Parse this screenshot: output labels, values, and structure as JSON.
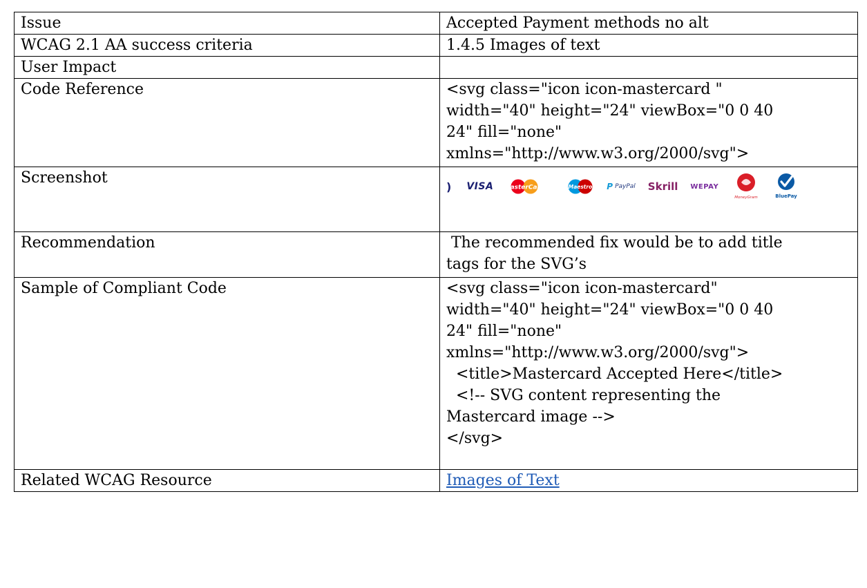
{
  "rows": {
    "issue": {
      "label": "Issue",
      "value": "Accepted Payment methods no alt"
    },
    "criteria": {
      "label": "WCAG 2.1 AA success criteria",
      "value": "1.4.5 Images of text"
    },
    "impact": {
      "label": "User Impact",
      "value": ""
    },
    "code_reference": {
      "label": "Code Reference",
      "value": "<svg class=\"icon icon-mastercard \"\nwidth=\"40\" height=\"24\" viewBox=\"0 0 40\n24\" fill=\"none\"\nxmlns=\"http://www.w3.org/2000/svg\">"
    },
    "screenshot": {
      "label": "Screenshot",
      "logos": {
        "visa": "VISA",
        "mastercard": "MasterCard",
        "maestro": "Maestro",
        "paypal": "PayPal",
        "skrill": "Skrill",
        "wepay": "WEPAY",
        "moneygram": "MoneyGram",
        "bluepay": "BluePay"
      }
    },
    "recommendation": {
      "label": "Recommendation",
      "value": " The recommended fix would be to add title\ntags for the SVG’s"
    },
    "compliant_code": {
      "label": "Sample of Compliant Code",
      "value": "<svg class=\"icon icon-mastercard\"\nwidth=\"40\" height=\"24\" viewBox=\"0 0 40\n24\" fill=\"none\"\nxmlns=\"http://www.w3.org/2000/svg\">\n  <title>Mastercard Accepted Here</title>\n  <!-- SVG content representing the\nMastercard image -->\n</svg>"
    },
    "resource": {
      "label": "Related WCAG Resource",
      "link_text": "Images of Text"
    }
  },
  "colors": {
    "link": "#1f5bb6",
    "border": "#000000"
  }
}
